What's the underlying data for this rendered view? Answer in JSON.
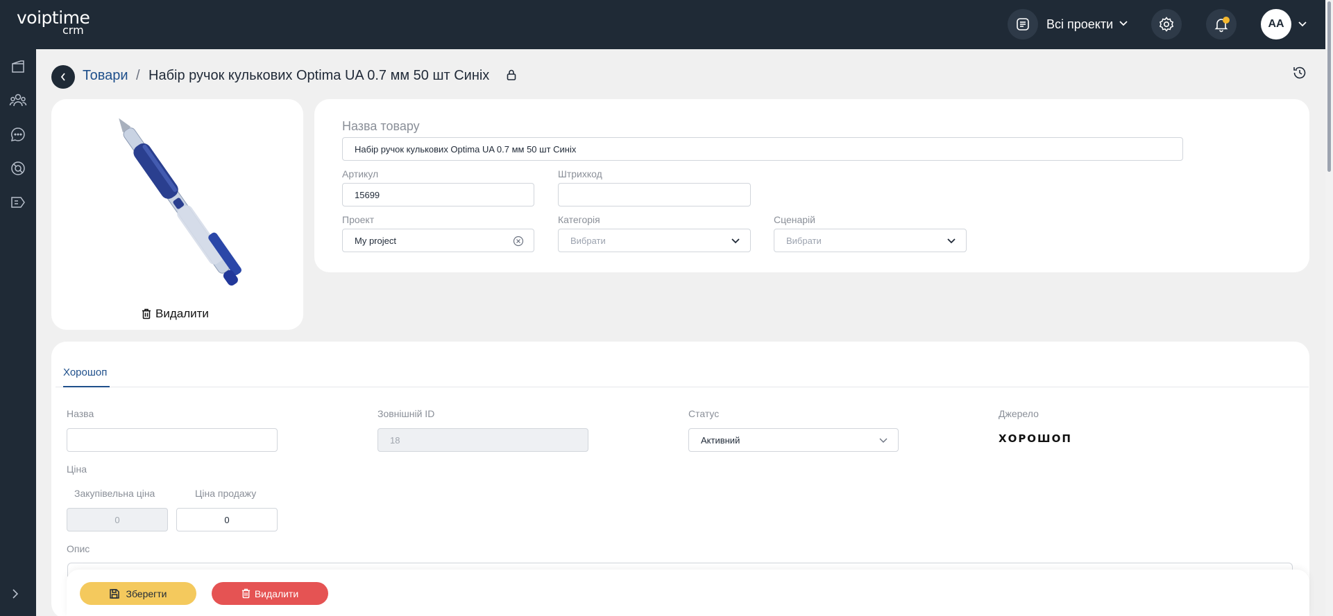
{
  "header": {
    "logo_main": "voiptime",
    "logo_sub": "crm",
    "projects_label": "Всі проекти",
    "avatar_initials": "AA",
    "notification_dot_color": "#f5b82e"
  },
  "sidebar": {
    "icons": [
      "contacts-book-icon",
      "users-icon",
      "chat-icon",
      "support-icon",
      "tag-list-icon"
    ]
  },
  "breadcrumb": {
    "parent": "Товари",
    "separator": "/",
    "current": "Набір ручок кулькових Optima UA 0.7 мм 50 шт Синіх"
  },
  "image_card": {
    "delete_label": "Видалити"
  },
  "product_form": {
    "name_label": "Назва товару",
    "name_value": "Набір ручок кулькових Optima UA 0.7 мм 50 шт Синіх",
    "sku_label": "Артикул",
    "sku_value": "15699",
    "barcode_label": "Штрихкод",
    "barcode_value": "",
    "project_label": "Проект",
    "project_value": "My project",
    "category_label": "Категорія",
    "category_placeholder": "Вибрати",
    "scenario_label": "Сценарій",
    "scenario_placeholder": "Вибрати"
  },
  "integration": {
    "tab_label": "Хорошоп",
    "name_label": "Назва",
    "name_value": "",
    "external_id_label": "Зовнішній ID",
    "external_id_value": "18",
    "status_label": "Статус",
    "status_value": "Активний",
    "source_label": "Джерело",
    "source_value": "ХОРОШОП",
    "price_label": "Ціна",
    "purchase_price_label": "Закупівельна ціна",
    "purchase_price_value": "0",
    "sale_price_label": "Ціна продажу",
    "sale_price_value": "0",
    "description_label": "Опис"
  },
  "footer": {
    "save_label": "Зберегти",
    "delete_label": "Видалити"
  },
  "colors": {
    "topbar": "#1f2a36",
    "accent_link": "#1e4f8b",
    "save_button": "#f4c95d",
    "delete_button": "#e55353"
  }
}
